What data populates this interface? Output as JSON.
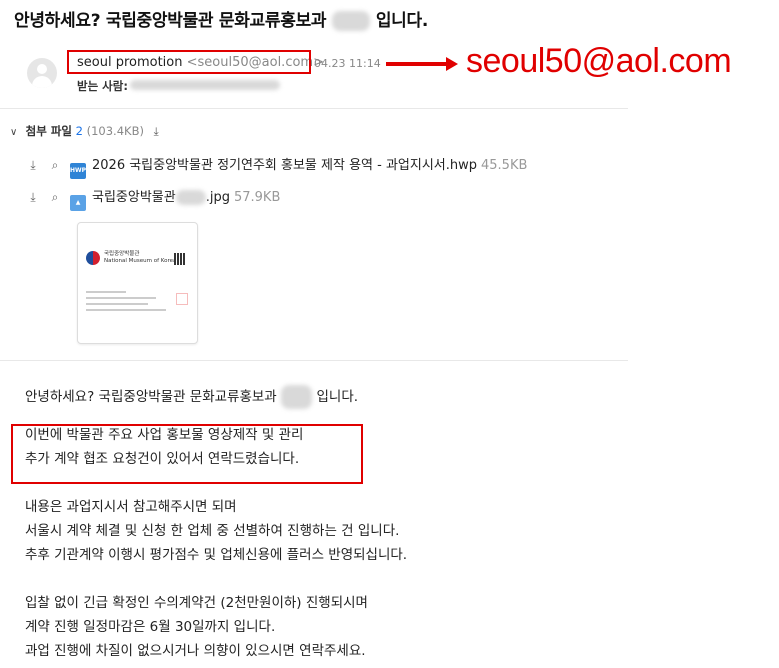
{
  "email": {
    "subject_before": "안녕하세요? 국립중앙박물관 문화교류홍보과",
    "subject_redacted": "███",
    "subject_after": " 입니다.",
    "sender_name": "seoul promotion",
    "sender_address": "<seoul50@aol.com>",
    "date": "04.23 11:14",
    "to_label": "받는 사람:",
    "to_value": "██████████"
  },
  "annotation": {
    "callout_text": "seoul50@aol.com",
    "accent_color": "#e00000"
  },
  "attachments": {
    "title": "첨부 파일",
    "count": "2",
    "total_size": "(103.4KB)",
    "files": [
      {
        "type_badge": "HWP",
        "name": "2026 국립중앙박물관 정기연주회 홍보물 제작 용역 - 과업지시서.hwp",
        "size": "45.5KB"
      },
      {
        "type_badge": "",
        "name_before": "국립중앙박물관",
        "name_redacted": "███",
        "name_after": ".jpg",
        "size": "57.9KB"
      }
    ],
    "preview": {
      "org_name_ko": "국립중앙박물관",
      "org_name_en": "National Museum of Korea"
    }
  },
  "body": {
    "greeting_before": "안녕하세요? 국립중앙박물관 문화교류홍보과",
    "greeting_redacted": "███",
    "greeting_after": " 입니다.",
    "highlight_1": "이번에 박물관 주요 사업 홍보물 영상제작 및 관리",
    "highlight_2": "추가 계약 협조 요청건이 있어서 연락드렸습니다.",
    "para2_1": "내용은 과업지시서 참고해주시면 되며",
    "para2_2": "서울시 계약 체결 및 신청 한 업체 중 선별하여 진행하는 건 입니다.",
    "para2_3": "추후 기관계약 이행시 평가점수 및 업체신용에 플러스 반영되십니다.",
    "para3_1": "입찰 없이 긴급 확정인 수의계약건 (2천만원이하) 진행되시며",
    "para3_2": "계약 진행 일정마감은 6월 30일까지 입니다.",
    "para3_3": "과업 진행에 차질이 없으시거나 의향이 있으시면 연락주세요."
  }
}
